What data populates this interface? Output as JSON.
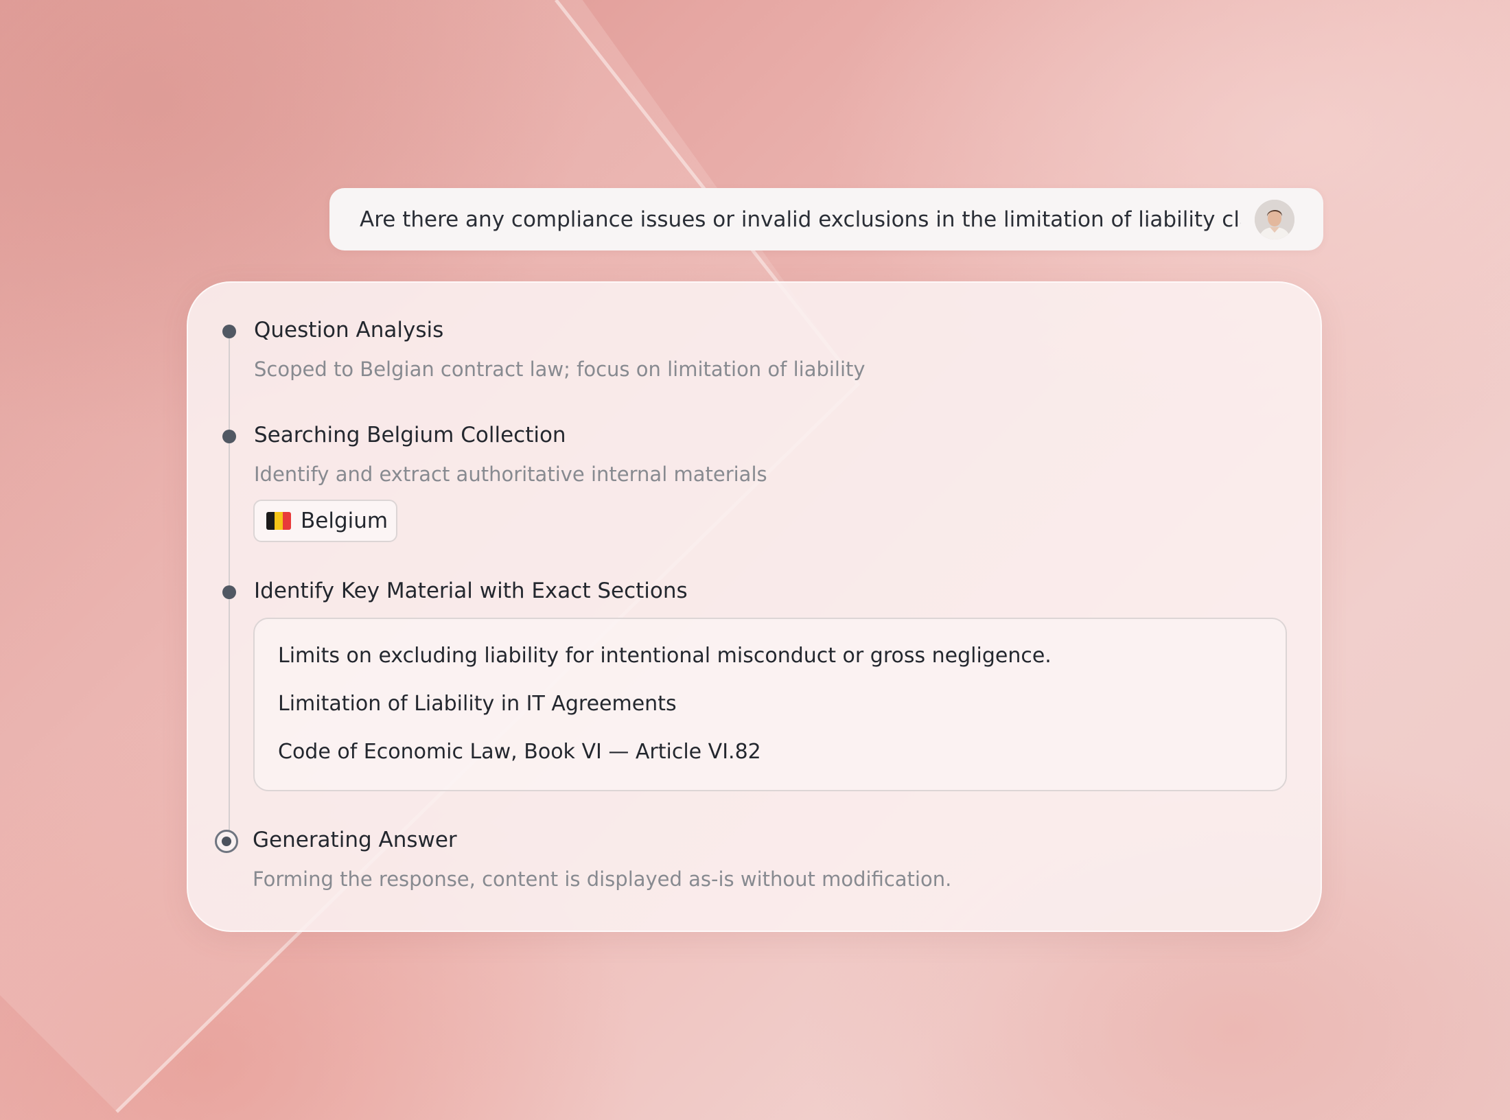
{
  "user_message": {
    "text": "Are there any compliance issues or invalid exclusions in the limitation of liability clause"
  },
  "steps": [
    {
      "title": "Question Analysis",
      "subtitle": "Scoped to Belgian contract law; focus on limitation of liability",
      "status": "done"
    },
    {
      "title": "Searching Belgium Collection",
      "subtitle": "Identify and extract authoritative internal materials",
      "status": "done",
      "chip": {
        "label": "Belgium",
        "icon": "belgium-flag-icon",
        "flag_colors": [
          "#1b1b1b",
          "#f5c518",
          "#e83a3a"
        ]
      }
    },
    {
      "title": "Identify Key Material with Exact Sections",
      "status": "done",
      "sections": [
        "Limits on excluding liability for intentional misconduct or gross negligence.",
        "Limitation of Liability in IT Agreements",
        "Code of Economic Law, Book VI — Article VI.82"
      ]
    },
    {
      "title": "Generating Answer",
      "subtitle": "Forming the response, content is displayed as-is without modification.",
      "status": "in-progress"
    }
  ],
  "colors": {
    "dot": "#515863",
    "title_text": "#23272e",
    "subtitle_text": "#878a90",
    "border": "#dcd5d5"
  }
}
